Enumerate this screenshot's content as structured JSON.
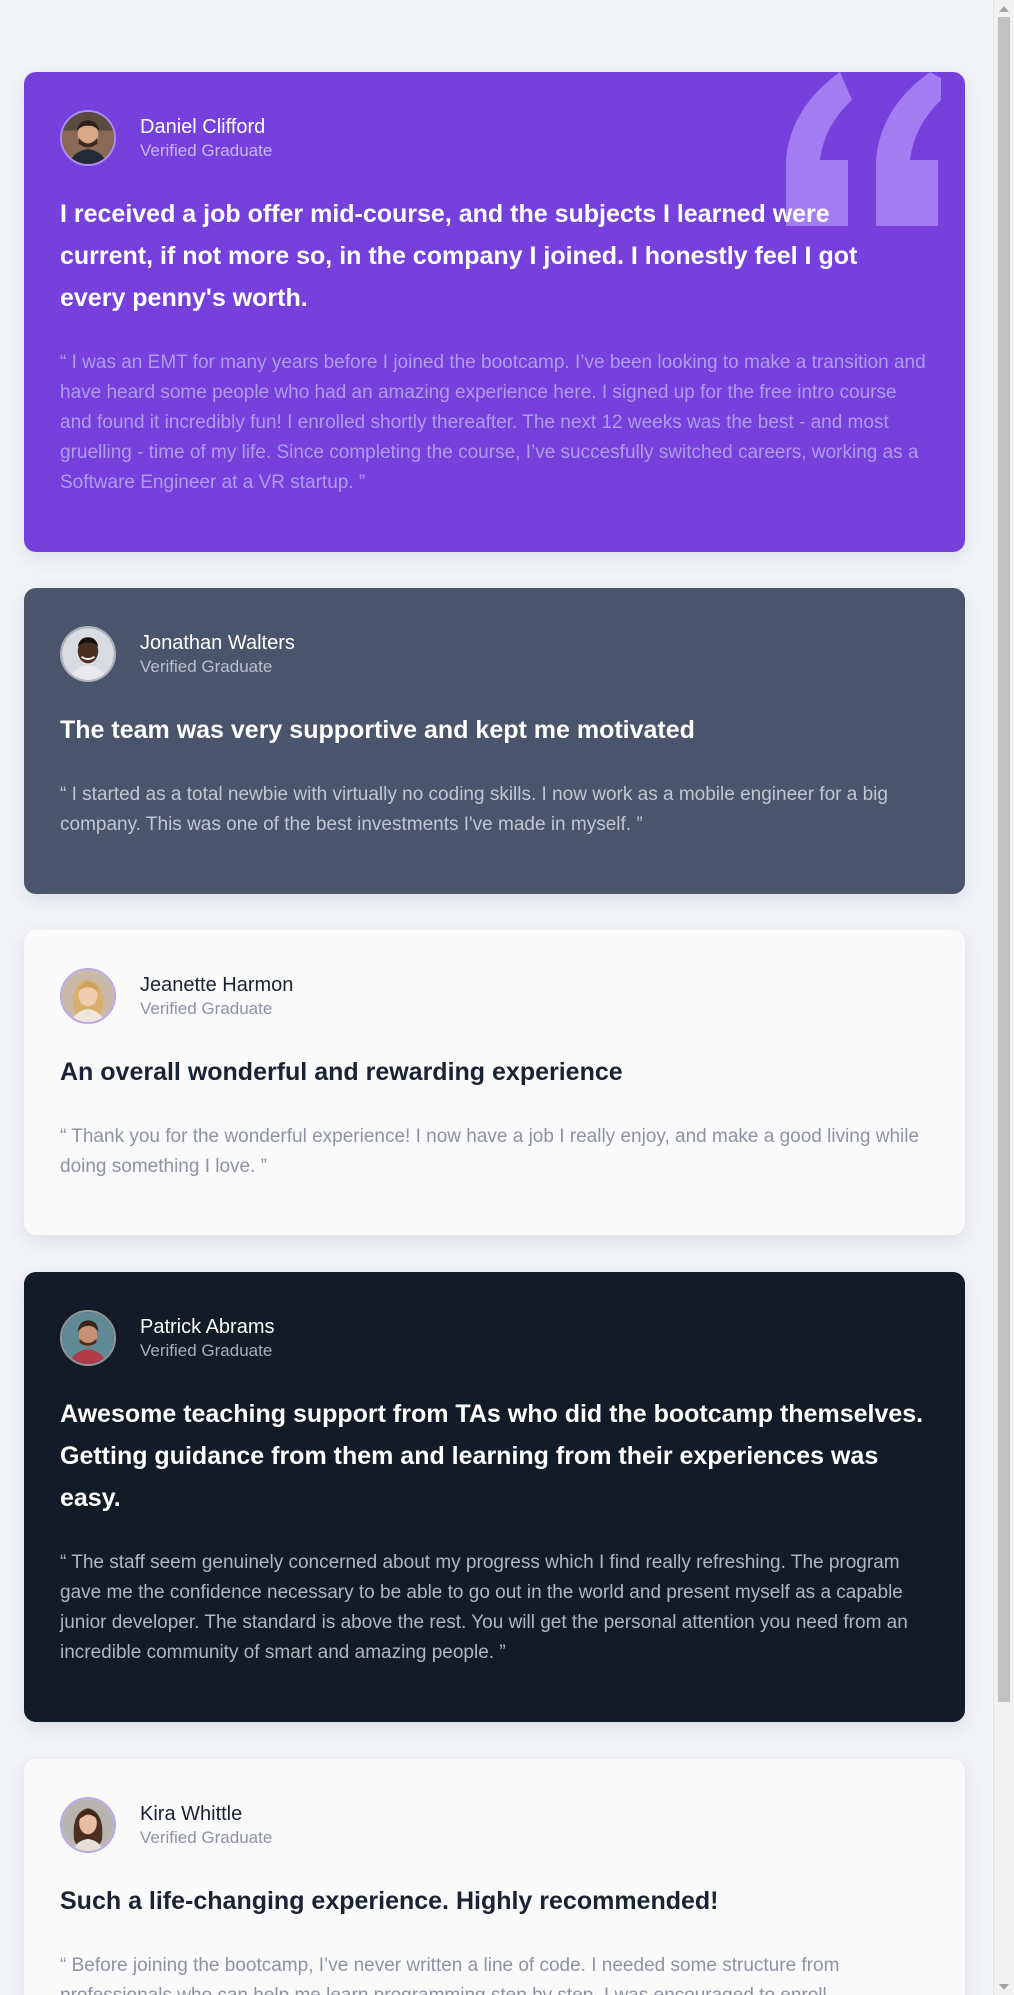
{
  "colors": {
    "purple_card": "#7540dc",
    "slate_card": "#48556a",
    "light_card": "#fafafb",
    "dark_card": "#131a28",
    "page_background": "#f2f4f8"
  },
  "testimonials": [
    {
      "name": "Daniel Clifford",
      "status": "Verified Graduate",
      "headline": "I received a job offer mid-course, and the subjects I learned were current, if not more so, in the company I joined. I honestly feel I got every penny's worth.",
      "body": "“ I was an EMT for many years before I joined the bootcamp. I’ve been looking to make a transition and have heard some people who had an amazing experience here. I signed up for the free intro course and found it incredibly fun! I enrolled shortly thereafter. The next 12 weeks was the best - and most gruelling - time of my life. Since completing the course, I’ve succesfully switched careers, working as a Software Engineer at a VR startup. ”"
    },
    {
      "name": "Jonathan Walters",
      "status": "Verified Graduate",
      "headline": "The team was very supportive and kept me motivated",
      "body": "“ I started as a total newbie with virtually no coding skills. I now work as a mobile engineer for a big company. This was one of the best investments I've made in myself. ”"
    },
    {
      "name": "Jeanette Harmon",
      "status": "Verified Graduate",
      "headline": "An overall wonderful and rewarding experience",
      "body": "“ Thank you for the wonderful experience! I now have a job I really enjoy, and make a good living while doing something I love. ”"
    },
    {
      "name": "Patrick Abrams",
      "status": "Verified Graduate",
      "headline": "Awesome teaching support from TAs who did the bootcamp themselves. Getting guidance from them and learning from their experiences was easy.",
      "body": "“ The staff seem genuinely concerned about my progress which I find really refreshing. The program gave me the confidence necessary to be able to go out in the world and present myself as a capable junior developer. The standard is above the rest. You will get the personal attention you need from an incredible community of smart and amazing people. ”"
    },
    {
      "name": "Kira Whittle",
      "status": "Verified Graduate",
      "headline": "Such a life-changing experience. Highly recommended!",
      "body": "“ Before joining the bootcamp, I’ve never written a line of code. I needed some structure from professionals who can help me learn programming step by step. I was encouraged to enroll"
    }
  ]
}
